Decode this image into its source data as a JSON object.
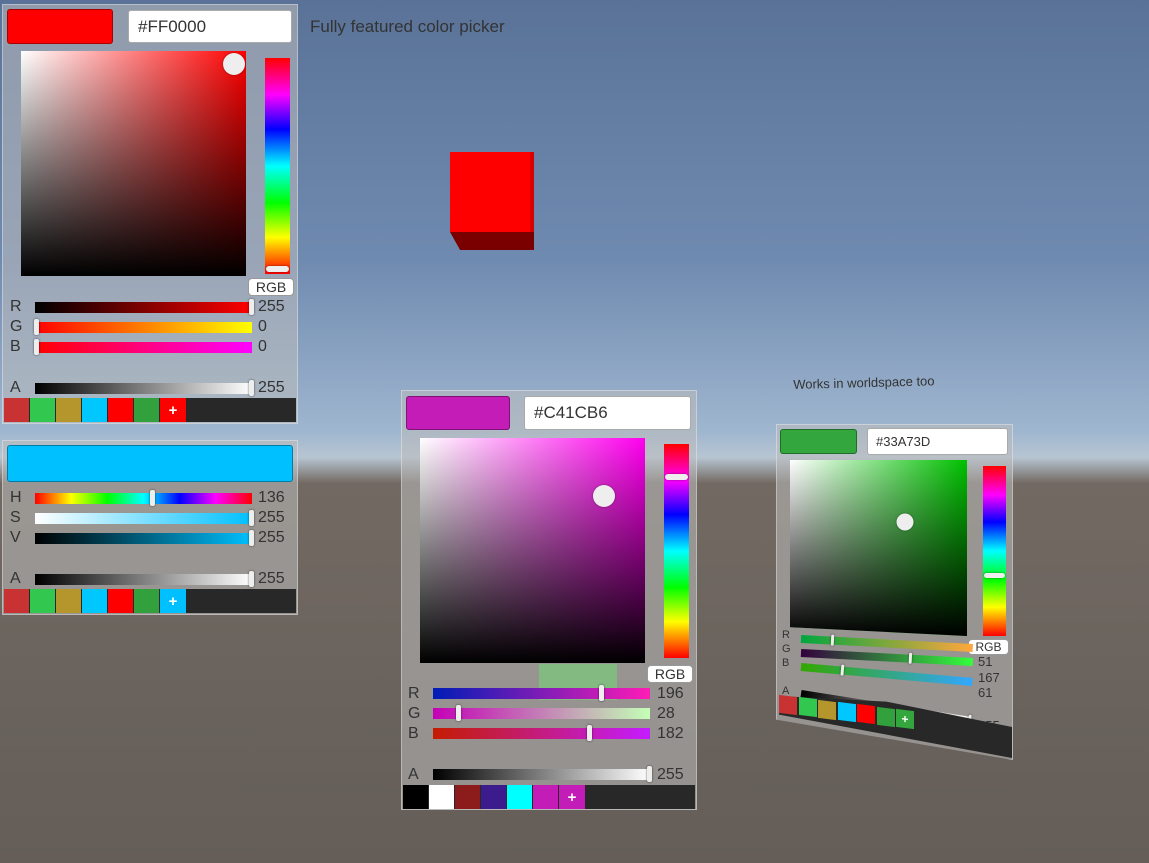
{
  "header": {
    "caption": "Fully featured color picker"
  },
  "picker1": {
    "preview_color": "#FF0000",
    "hex": "#FF0000",
    "mode_button": "RGB",
    "sliders": [
      {
        "label": "R",
        "value": "255"
      },
      {
        "label": "G",
        "value": "0"
      },
      {
        "label": "B",
        "value": "0"
      },
      {
        "label": "A",
        "value": "255"
      }
    ],
    "presets": [
      "#c83232",
      "#32c850",
      "#b4962d",
      "#00c8ff",
      "#ff0000",
      "#32a03c"
    ],
    "add_label": "+"
  },
  "picker2": {
    "preview_color": "#00C0FF",
    "sliders": [
      {
        "label": "H",
        "value": "136"
      },
      {
        "label": "S",
        "value": "255"
      },
      {
        "label": "V",
        "value": "255"
      },
      {
        "label": "A",
        "value": "255"
      }
    ],
    "presets": [
      "#c83232",
      "#32c850",
      "#b4962d",
      "#00c8ff",
      "#ff0000",
      "#32a03c"
    ],
    "add_label": "+"
  },
  "picker3": {
    "preview_color": "#C41CB6",
    "hex": "#C41CB6",
    "mode_button": "RGB",
    "sliders": [
      {
        "label": "R",
        "value": "196"
      },
      {
        "label": "G",
        "value": "28"
      },
      {
        "label": "B",
        "value": "182"
      },
      {
        "label": "A",
        "value": "255"
      }
    ],
    "presets": [
      "#000000",
      "#ffffff",
      "#8c1c1c",
      "#3c1c8c",
      "#00ffff",
      "#c41cb6"
    ],
    "add_label": "+"
  },
  "worldspace": {
    "caption": "Works in worldspace too",
    "preview_color": "#33A73D",
    "hex": "#33A73D",
    "mode_button": "RGB",
    "sliders": [
      {
        "label": "R",
        "value": "51"
      },
      {
        "label": "G",
        "value": "167"
      },
      {
        "label": "B",
        "value": "61"
      },
      {
        "label": "A",
        "value": "255"
      }
    ],
    "presets": [
      "#c83232",
      "#32c850",
      "#b4962d",
      "#00c8ff",
      "#ff0000",
      "#32a03c"
    ],
    "add_label": "+"
  }
}
